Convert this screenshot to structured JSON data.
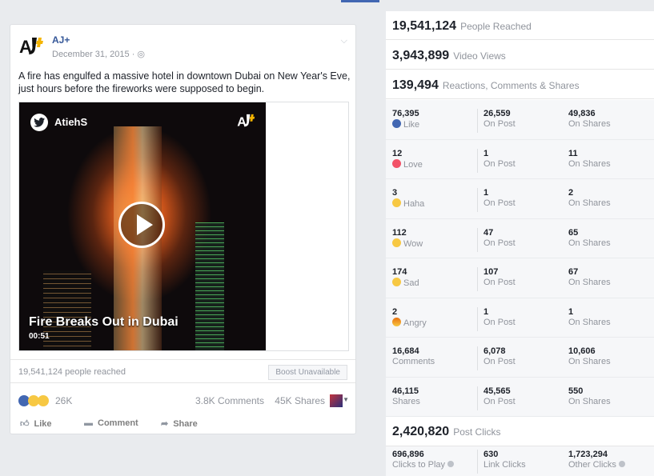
{
  "post": {
    "page_name": "AJ+",
    "date": "December 31, 2015",
    "text": "A fire has engulfed a massive hotel in downtown Dubai on New Year's Eve, just hours before the fireworks were supposed to begin.",
    "video": {
      "author": "AtiehS",
      "title": "Fire Breaks Out in Dubai",
      "duration": "00:51"
    },
    "reach_text": "19,541,124 people reached",
    "boost_label": "Boost Unavailable",
    "reactions_count": "26K",
    "comments": "3.8K Comments",
    "shares": "45K Shares",
    "actions": {
      "like": "Like",
      "comment": "Comment",
      "share": "Share"
    },
    "icons": [
      "aj-logo-icon",
      "globe-icon",
      "chevron-down-icon",
      "twitter-icon",
      "play-icon",
      "like-icon",
      "comment-icon",
      "share-icon"
    ]
  },
  "stats": {
    "people_reached": {
      "value": "19,541,124",
      "label": "People Reached"
    },
    "video_views": {
      "value": "3,943,899",
      "label": "Video Views"
    },
    "engagement": {
      "value": "139,494",
      "label": "Reactions, Comments & Shares"
    },
    "rows": [
      {
        "total": "76,395",
        "label": "Like",
        "on_post": "26,559",
        "on_post_label": "On Post",
        "on_shares": "49,836",
        "on_shares_label": "On Shares"
      },
      {
        "total": "12",
        "label": "Love",
        "on_post": "1",
        "on_post_label": "On Post",
        "on_shares": "11",
        "on_shares_label": "On Shares"
      },
      {
        "total": "3",
        "label": "Haha",
        "on_post": "1",
        "on_post_label": "On Post",
        "on_shares": "2",
        "on_shares_label": "On Shares"
      },
      {
        "total": "112",
        "label": "Wow",
        "on_post": "47",
        "on_post_label": "On Post",
        "on_shares": "65",
        "on_shares_label": "On Shares"
      },
      {
        "total": "174",
        "label": "Sad",
        "on_post": "107",
        "on_post_label": "On Post",
        "on_shares": "67",
        "on_shares_label": "On Shares"
      },
      {
        "total": "2",
        "label": "Angry",
        "on_post": "1",
        "on_post_label": "On Post",
        "on_shares": "1",
        "on_shares_label": "On Shares"
      },
      {
        "total": "16,684",
        "label": "Comments",
        "on_post": "6,078",
        "on_post_label": "On Post",
        "on_shares": "10,606",
        "on_shares_label": "On Shares"
      },
      {
        "total": "46,115",
        "label": "Shares",
        "on_post": "45,565",
        "on_post_label": "On Post",
        "on_shares": "550",
        "on_shares_label": "On Shares"
      }
    ],
    "post_clicks": {
      "value": "2,420,820",
      "label": "Post Clicks"
    },
    "clicks": [
      {
        "value": "696,896",
        "label": "Clicks to Play"
      },
      {
        "value": "630",
        "label": "Link Clicks"
      },
      {
        "value": "1,723,294",
        "label": "Other Clicks"
      }
    ]
  },
  "colors": {
    "brand_blue": "#4267b2",
    "link_blue": "#365899",
    "muted_text": "#90949c",
    "love_red": "#f25268",
    "emoji_yellow": "#f7c843"
  }
}
